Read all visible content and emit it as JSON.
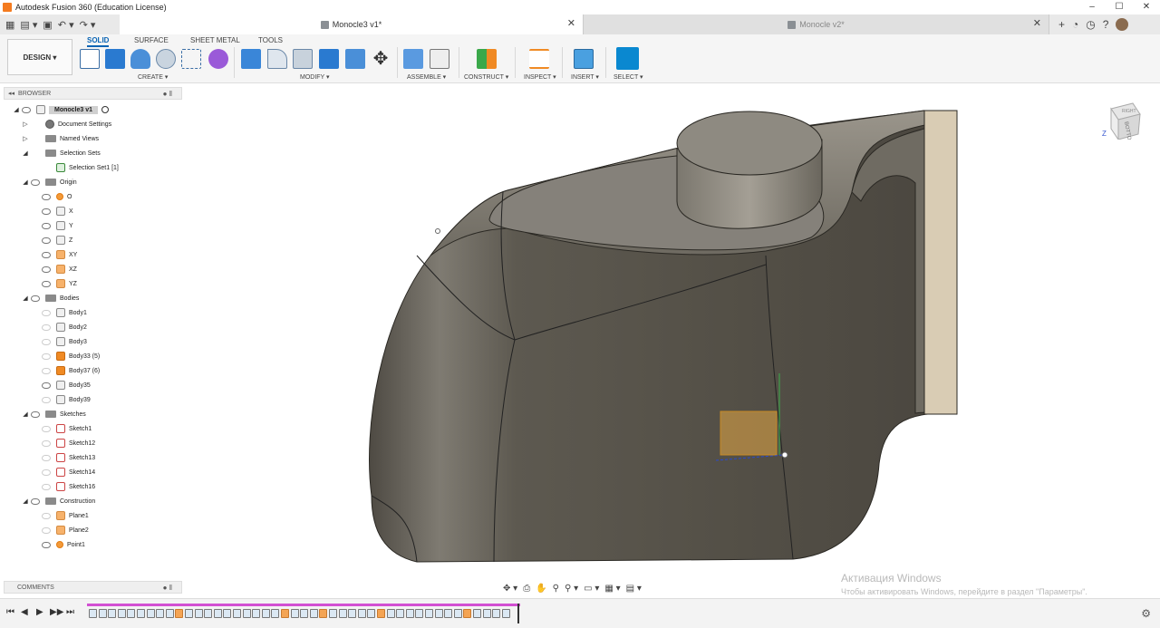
{
  "window": {
    "title": "Autodesk Fusion 360 (Education License)",
    "controls": [
      "–",
      "☐",
      "✕"
    ]
  },
  "tabs": {
    "quick_access": [
      "▦",
      "▤ ▾",
      "▣",
      "↶ ▾",
      "↷ ▾"
    ],
    "active": {
      "label": "Monocle3 v1*",
      "close": "✕"
    },
    "inactive": {
      "label": "Monocle v2*",
      "close": "✕"
    },
    "right_controls": [
      "+",
      "◔",
      "◷",
      "?"
    ]
  },
  "toolbar": {
    "workspace": "DESIGN ▾",
    "tool_tabs": [
      "SOLID",
      "SURFACE",
      "SHEET METAL",
      "TOOLS"
    ],
    "groups": [
      "CREATE ▾",
      "MODIFY ▾",
      "ASSEMBLE ▾",
      "CONSTRUCT ▾",
      "INSPECT ▾",
      "INSERT ▾",
      "SELECT ▾"
    ]
  },
  "browser": {
    "title": "BROWSER",
    "collapse_glyph": "◂◂",
    "pin_glyph": "● ‖",
    "root": "Monocle3 v1",
    "items": [
      {
        "label": "Document Settings",
        "depth": 1,
        "tri": "▷",
        "icon": "gear"
      },
      {
        "label": "Named Views",
        "depth": 1,
        "tri": "▷",
        "icon": "folder"
      },
      {
        "label": "Selection Sets",
        "depth": 1,
        "tri": "◢",
        "icon": "folder"
      },
      {
        "label": "Selection Set1 [1]",
        "depth": 2,
        "tri": "",
        "icon": "selset"
      },
      {
        "label": "Origin",
        "depth": 1,
        "tri": "◢",
        "icon": "folder",
        "eye": true
      },
      {
        "label": "O",
        "depth": 2,
        "tri": "",
        "icon": "origin",
        "eye": true
      },
      {
        "label": "X",
        "depth": 2,
        "tri": "",
        "icon": "axis",
        "eye": true
      },
      {
        "label": "Y",
        "depth": 2,
        "tri": "",
        "icon": "axis",
        "eye": true
      },
      {
        "label": "Z",
        "depth": 2,
        "tri": "",
        "icon": "axis",
        "eye": true
      },
      {
        "label": "XY",
        "depth": 2,
        "tri": "",
        "icon": "plane",
        "eye": true
      },
      {
        "label": "XZ",
        "depth": 2,
        "tri": "",
        "icon": "plane",
        "eye": true
      },
      {
        "label": "YZ",
        "depth": 2,
        "tri": "",
        "icon": "plane",
        "eye": true
      },
      {
        "label": "Bodies",
        "depth": 1,
        "tri": "◢",
        "icon": "folder",
        "eye": true
      },
      {
        "label": "Body1",
        "depth": 2,
        "tri": "",
        "icon": "body",
        "eye": false
      },
      {
        "label": "Body2",
        "depth": 2,
        "tri": "",
        "icon": "body",
        "eye": false
      },
      {
        "label": "Body3",
        "depth": 2,
        "tri": "",
        "icon": "body",
        "eye": false
      },
      {
        "label": "Body33 (5)",
        "depth": 2,
        "tri": "",
        "icon": "orange",
        "eye": false
      },
      {
        "label": "Body37 (6)",
        "depth": 2,
        "tri": "",
        "icon": "orange",
        "eye": false
      },
      {
        "label": "Body35",
        "depth": 2,
        "tri": "",
        "icon": "body",
        "eye": true
      },
      {
        "label": "Body39",
        "depth": 2,
        "tri": "",
        "icon": "body",
        "eye": false
      },
      {
        "label": "Sketches",
        "depth": 1,
        "tri": "◢",
        "icon": "folder",
        "eye": true
      },
      {
        "label": "Sketch1",
        "depth": 2,
        "tri": "",
        "icon": "sketch",
        "eye": false
      },
      {
        "label": "Sketch12",
        "depth": 2,
        "tri": "",
        "icon": "sketch",
        "eye": false
      },
      {
        "label": "Sketch13",
        "depth": 2,
        "tri": "",
        "icon": "sketch",
        "eye": false
      },
      {
        "label": "Sketch14",
        "depth": 2,
        "tri": "",
        "icon": "sketch",
        "eye": false
      },
      {
        "label": "Sketch16",
        "depth": 2,
        "tri": "",
        "icon": "sketch",
        "eye": false
      },
      {
        "label": "Construction",
        "depth": 1,
        "tri": "◢",
        "icon": "folder",
        "eye": true
      },
      {
        "label": "Plane1",
        "depth": 2,
        "tri": "",
        "icon": "plane",
        "eye": false
      },
      {
        "label": "Plane2",
        "depth": 2,
        "tri": "",
        "icon": "plane",
        "eye": false
      },
      {
        "label": "Point1",
        "depth": 2,
        "tri": "",
        "icon": "origin",
        "eye": true
      }
    ]
  },
  "comments": {
    "label": "COMMENTS",
    "pin_glyph": "● ‖"
  },
  "viewcube": {
    "faces": [
      "RIGHT",
      "BOTTOM"
    ],
    "axis": "Z"
  },
  "navbar": [
    "✥ ▾",
    "⎙",
    "✋",
    "⚲",
    "⚲ ▾",
    "▭ ▾",
    "▦ ▾",
    "▤ ▾"
  ],
  "watermark": {
    "line1": "Активация Windows",
    "line2": "Чтобы активировать Windows, перейдите в раздел \"Параметры\"."
  },
  "timeline": {
    "controls": [
      "⏮",
      "◀",
      "▶",
      "▶▶",
      "⏭"
    ],
    "items": 44,
    "settings_glyph": "⚙"
  },
  "colors": {
    "accent": "#0a64b4",
    "model": "#5a564d",
    "timeline_bar": "#d24fd2"
  }
}
